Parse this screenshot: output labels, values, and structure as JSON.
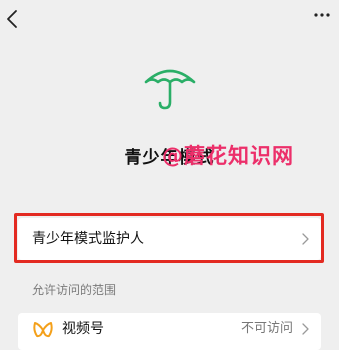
{
  "header": {
    "back_icon": "chevron-left-icon",
    "more_icon": "more-dots-icon"
  },
  "hero": {
    "icon": "umbrella-icon",
    "icon_color": "#2aae67",
    "title": "青少年模式"
  },
  "watermark": {
    "text": "@蘑花知识网",
    "color": "#ec2f6a"
  },
  "guardian": {
    "label": "青少年模式监护人",
    "highlight_color": "#e32a21"
  },
  "access": {
    "section_label": "允许访问的范围",
    "items": [
      {
        "label": "视频号",
        "value": "不可访问",
        "icon": "channels-icon",
        "icon_color": "#f4a01a"
      }
    ]
  }
}
